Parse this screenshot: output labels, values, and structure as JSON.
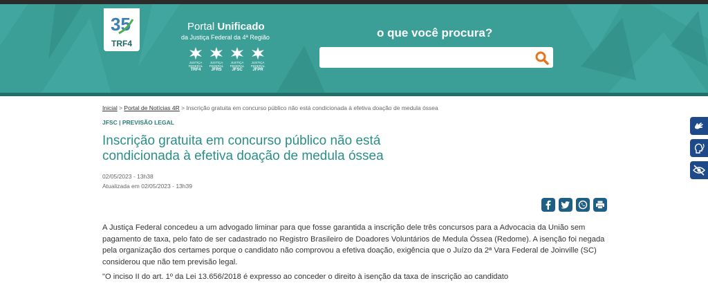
{
  "header": {
    "logo_number": "35",
    "logo_text": "TRF4",
    "portal_title_a": "Portal ",
    "portal_title_b": "Unificado",
    "portal_subtitle": "da Justiça Federal da 4ª Região",
    "orgs": [
      {
        "small": "JUSTIÇA FEDERAL",
        "big": "TRF4"
      },
      {
        "small": "JUSTIÇA FEDERAL",
        "big": "JFRS"
      },
      {
        "small": "JUSTIÇA FEDERAL",
        "big": "JFSC"
      },
      {
        "small": "JUSTIÇA FEDERAL",
        "big": "JFPR"
      }
    ],
    "search_title": "o que você procura?",
    "search_value": "",
    "colors": {
      "teal": "#3b9f98",
      "accent": "#e8731a"
    }
  },
  "breadcrumb": {
    "item1": "Inicial",
    "sep": " > ",
    "item2": "Portal de Notícias 4R",
    "item3": "Inscrição gratuita em concurso público não está condicionada à efetiva doação de medula óssea"
  },
  "article": {
    "category": "JFSC | PREVISÃO LEGAL",
    "title": "Inscrição gratuita em concurso público não está condicionada à efetiva doação de medula óssea",
    "date": "02/05/2023 - 13h38",
    "updated": "Atualizada em 02/05/2023 - 13h39",
    "paragraph1": "A Justiça Federal concedeu a um advogado liminar para que fosse garantida a inscrição dele três concursos para a Advocacia da União sem pagamento de taxa, pelo fato de ser cadastrado no Registro Brasileiro de Doadores Voluntários de Medula Óssea (Redome). A isenção foi negada pela organização dos certames porque o candidato não comprovou a efetiva doação, exigência que o Juízo da 2ª Vara Federal de Joinville (SC) considerou que não tem previsão legal.",
    "paragraph2": "\"O inciso II do art. 1º da Lei 13.656/2018 é expresso ao conceder o direito à isenção da taxa de inscrição ao candidato"
  },
  "share": {
    "icons": [
      "facebook-icon",
      "twitter-icon",
      "whatsapp-icon",
      "print-icon"
    ]
  },
  "accessibility": {
    "icons": [
      "sign-language-icon",
      "audio-description-icon",
      "visibility-icon"
    ]
  }
}
